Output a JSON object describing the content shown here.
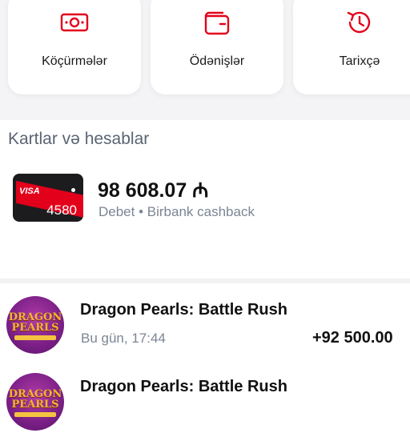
{
  "quick_actions": [
    {
      "label": "Köçürmələr",
      "icon": "cash-icon"
    },
    {
      "label": "Ödənişlər",
      "icon": "wallet-icon"
    },
    {
      "label": "Tarixçə",
      "icon": "history-icon"
    }
  ],
  "colors": {
    "accent": "#e3001b",
    "muted_text": "#7c8594",
    "section_title": "#5b6472"
  },
  "accounts_section": {
    "title": "Kartlar və hesablar",
    "card": {
      "brand": "VISA",
      "last4": "4580",
      "balance": "98 608.07 ₼",
      "subtitle": "Debet • Birbank cashback"
    }
  },
  "transactions": [
    {
      "merchant": "Dragon Pearls: Battle Rush",
      "time": "Bu gün, 17:44",
      "amount": "+92 500.00",
      "logo_text": "DRAGON PEARLS"
    },
    {
      "merchant": "Dragon Pearls: Battle Rush",
      "time": "",
      "amount": "",
      "logo_text": "DRAGON PEARLS"
    }
  ]
}
